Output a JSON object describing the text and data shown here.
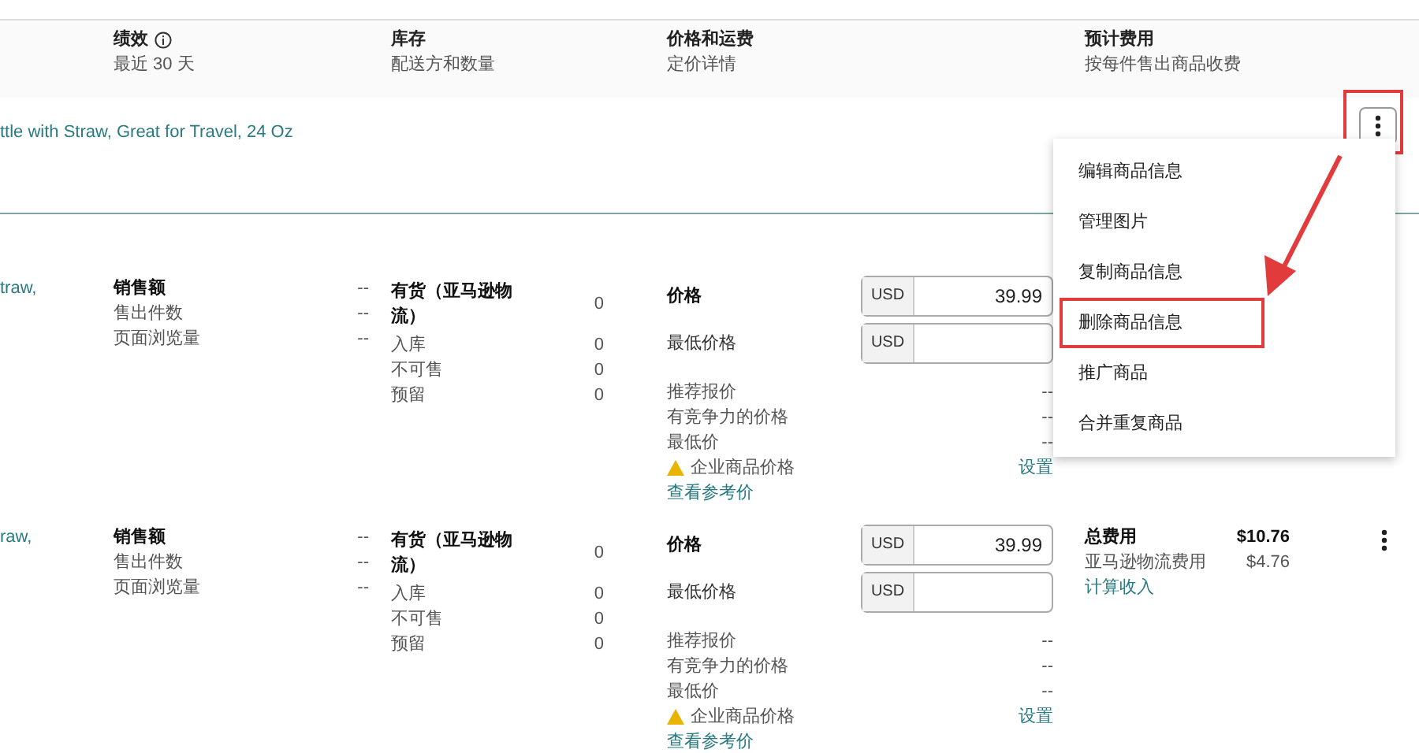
{
  "header": {
    "columns": [
      {
        "title": "绩效",
        "subtitle": "最近 30 天",
        "info": true
      },
      {
        "title": "库存",
        "subtitle": "配送方和数量"
      },
      {
        "title": "价格和运费",
        "subtitle": "定价详情"
      },
      {
        "title": "预计费用",
        "subtitle": "按每件售出商品收费"
      }
    ]
  },
  "listing_title": "ttle with Straw, Great for Travel, 24 Oz",
  "rows": [
    {
      "name": "traw,",
      "performance": [
        {
          "label": "销售额",
          "value": "--"
        },
        {
          "label": "售出件数",
          "value": "--"
        },
        {
          "label": "页面浏览量",
          "value": "--"
        }
      ],
      "inventory": [
        {
          "label": "有货（亚马逊物流）",
          "value": "0"
        },
        {
          "label": "入库",
          "value": "0"
        },
        {
          "label": "不可售",
          "value": "0"
        },
        {
          "label": "预留",
          "value": "0"
        }
      ],
      "price": {
        "fields": [
          {
            "label": "价格",
            "currency": "USD",
            "value": "39.99"
          },
          {
            "label": "最低价格",
            "currency": "USD"
          }
        ],
        "lines": [
          {
            "label": "推荐报价",
            "value": "--"
          },
          {
            "label": "有竞争力的价格",
            "value": "--"
          },
          {
            "label": "最低价",
            "value": "--"
          }
        ],
        "warning": {
          "label": "企业商品价格",
          "link": "设置"
        },
        "reference_link": "查看参考价"
      }
    },
    {
      "name": "raw,",
      "performance": [
        {
          "label": "销售额",
          "value": "--"
        },
        {
          "label": "售出件数",
          "value": "--"
        },
        {
          "label": "页面浏览量",
          "value": "--"
        }
      ],
      "inventory": [
        {
          "label": "有货（亚马逊物流）",
          "value": "0"
        },
        {
          "label": "入库",
          "value": "0"
        },
        {
          "label": "不可售",
          "value": "0"
        },
        {
          "label": "预留",
          "value": "0"
        }
      ],
      "price": {
        "fields": [
          {
            "label": "价格",
            "currency": "USD",
            "value": "39.99"
          },
          {
            "label": "最低价格",
            "currency": "USD"
          }
        ],
        "lines": [
          {
            "label": "推荐报价",
            "value": "--"
          },
          {
            "label": "有竞争力的价格",
            "value": "--"
          },
          {
            "label": "最低价",
            "value": "--"
          }
        ],
        "warning": {
          "label": "企业商品价格",
          "link": "设置"
        },
        "reference_link": "查看参考价"
      },
      "fees": {
        "lines": [
          {
            "label": "总费用",
            "value": "$10.76"
          },
          {
            "label": "亚马逊物流费用",
            "value": "$4.76"
          }
        ],
        "link": "计算收入"
      }
    }
  ],
  "menu": {
    "items": [
      {
        "label": "编辑商品信息",
        "highlighted": false
      },
      {
        "label": "管理图片",
        "highlighted": false
      },
      {
        "label": "复制商品信息",
        "highlighted": false
      },
      {
        "label": "删除商品信息",
        "highlighted": true
      },
      {
        "label": "推广商品",
        "highlighted": false
      },
      {
        "label": "合并重复商品",
        "highlighted": false
      }
    ]
  }
}
